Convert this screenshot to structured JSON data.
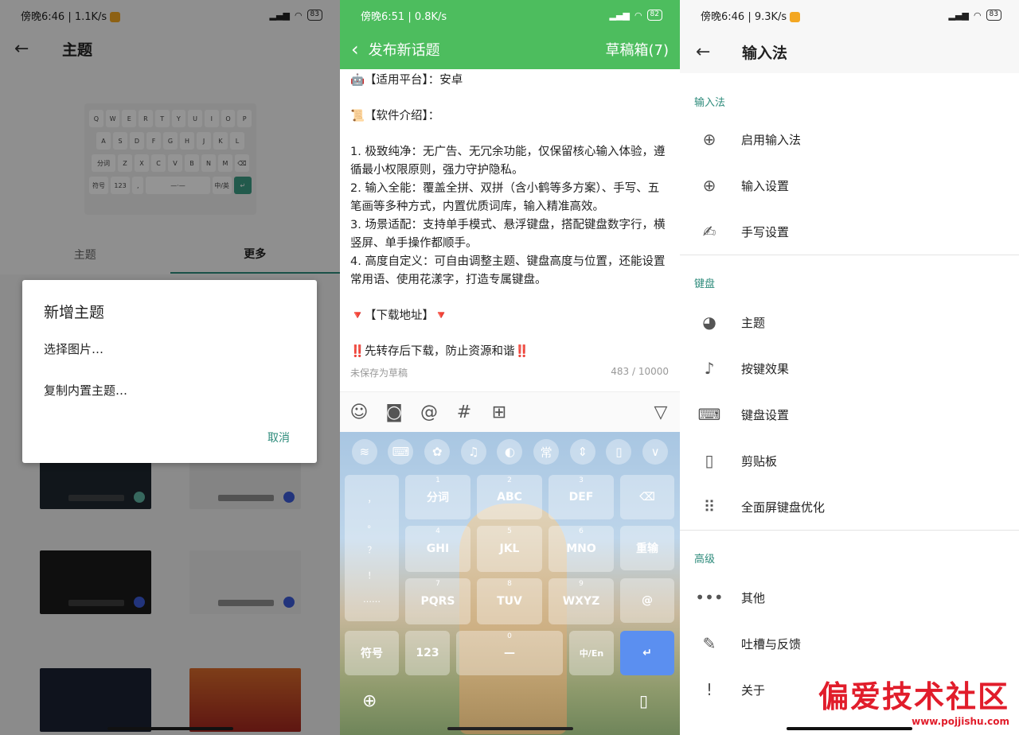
{
  "panel1": {
    "status_time": "傍晚6:46 | 1.1K/s",
    "battery": "83",
    "header_title": "主题",
    "keyboard_rows": [
      [
        "Q",
        "W",
        "E",
        "R",
        "T",
        "Y",
        "U",
        "I",
        "O",
        "P"
      ],
      [
        "A",
        "S",
        "D",
        "F",
        "G",
        "H",
        "J",
        "K",
        "L"
      ],
      [
        "分词",
        "Z",
        "X",
        "C",
        "V",
        "B",
        "N",
        "M",
        "⌫"
      ],
      [
        "符号",
        "123",
        ",",
        "—·—",
        "中/英",
        "↵"
      ]
    ],
    "tabs": [
      "主题",
      "更多"
    ],
    "dialog": {
      "title": "新增主题",
      "items": [
        "选择图片…",
        "复制内置主题…"
      ],
      "cancel": "取消"
    },
    "accent_color": "#2d8b7b"
  },
  "panel2": {
    "status_time": "傍晚6:51 | 0.8K/s",
    "battery": "82",
    "nav_title": "发布新话题",
    "nav_right": "草稿箱(7)",
    "post_lines": [
      "🤖【适用平台】：安卓",
      "📜【软件介绍】：",
      "1. 极致纯净：无广告、无冗余功能，仅保留核心输入体验，遵循最小权限原则，强力守护隐私。",
      "2. 输入全能：覆盖全拼、双拼（含小鹤等多方案）、手写、五笔画等多种方式，内置优质词库，输入精准高效。",
      "3. 场景适配：支持单手模式、悬浮键盘，搭配键盘数字行，横竖屏、单手操作都顺手。",
      "4. 高度自定义：可自由调整主题、键盘高度与位置，还能设置常用语、使用花漾字，打造专属键盘。",
      "🔻【下载地址】🔻",
      "‼️先转存后下载，防止资源和谐‼️"
    ],
    "draft_note": "未保存为草稿",
    "char_count": "483 / 10000",
    "toolbar_icons": [
      "emoji-icon",
      "camera-icon",
      "at-icon",
      "hashtag-icon",
      "add-icon",
      "collapse-icon"
    ],
    "kb_top_icons": [
      "logo-icon",
      "keyboard-icon",
      "settings-icon",
      "bell-icon",
      "contrast-icon",
      "常",
      "move-icon",
      "clipboard-icon",
      "chevron-down-icon"
    ],
    "left_col": [
      "，",
      "。",
      "？",
      "！",
      "……"
    ],
    "keys": [
      {
        "n": "1",
        "l": "分词"
      },
      {
        "n": "2",
        "l": "ABC"
      },
      {
        "n": "3",
        "l": "DEF"
      },
      {
        "n": "4",
        "l": "GHI"
      },
      {
        "n": "5",
        "l": "JKL"
      },
      {
        "n": "6",
        "l": "MNO"
      },
      {
        "n": "7",
        "l": "PQRS"
      },
      {
        "n": "8",
        "l": "TUV"
      },
      {
        "n": "9",
        "l": "WXYZ"
      }
    ],
    "right_keys": [
      "⌫",
      "重输",
      "@"
    ],
    "bottom_keys": {
      "symbol": "符号",
      "num": "123",
      "space": "0",
      "lang": "中/En",
      "enter": "↵"
    },
    "header_color": "#4dbd5e"
  },
  "panel3": {
    "status_time": "傍晚6:46 | 9.3K/s",
    "battery": "83",
    "nav_title": "输入法",
    "sections": [
      {
        "title": "输入法",
        "items": [
          {
            "icon": "globe-icon",
            "label": "启用输入法"
          },
          {
            "icon": "globe-icon",
            "label": "输入设置"
          },
          {
            "icon": "handwriting-icon",
            "label": "手写设置"
          }
        ]
      },
      {
        "title": "键盘",
        "items": [
          {
            "icon": "palette-icon",
            "label": "主题"
          },
          {
            "icon": "bell-vibrate-icon",
            "label": "按键效果"
          },
          {
            "icon": "keyboard-icon",
            "label": "键盘设置"
          },
          {
            "icon": "clipboard-icon",
            "label": "剪贴板"
          },
          {
            "icon": "keyboard-dots-icon",
            "label": "全面屏键盘优化"
          }
        ]
      },
      {
        "title": "高级",
        "items": [
          {
            "icon": "more-icon",
            "label": "其他"
          },
          {
            "icon": "edit-icon",
            "label": "吐槽与反馈"
          },
          {
            "icon": "exclamation-icon",
            "label": "关于"
          }
        ]
      }
    ],
    "watermark": {
      "main": "偏爱技术社区",
      "url": "www.pojjishu.com"
    }
  }
}
